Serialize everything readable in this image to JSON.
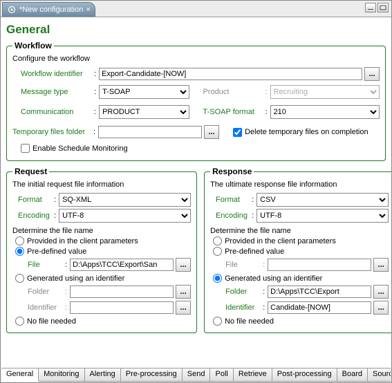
{
  "window": {
    "tab_title": "*New configuration",
    "minimize_tip": "Minimize",
    "maximize_tip": "Maximize"
  },
  "page_title": "General",
  "workflow": {
    "legend": "Workflow",
    "desc": "Configure the workflow",
    "identifier_label": "Workflow identifier",
    "identifier_value": "Export-Candidate-[NOW]",
    "message_type_label": "Message type",
    "message_type_value": "T-SOAP",
    "communication_label": "Communication",
    "communication_value": "PRODUCT",
    "product_label": "Product",
    "product_value": "Recruiting",
    "tsoap_format_label": "T-SOAP format",
    "tsoap_format_value": "210",
    "temp_folder_label": "Temporary files folder",
    "temp_folder_value": "",
    "delete_temp_label": "Delete temporary files on completion",
    "enable_schedule_label": "Enable Schedule Monitoring"
  },
  "request": {
    "legend": "Request",
    "desc": "The initial request file information",
    "format_label": "Format",
    "format_value": "SQ-XML",
    "encoding_label": "Encoding",
    "encoding_value": "UTF-8",
    "determine_label": "Determine the file name",
    "opt_client": "Provided in the client parameters",
    "opt_predef": "Pre-defined value",
    "file_label": "File",
    "file_value": "D:\\Apps\\TCC\\Export\\San",
    "opt_gen": "Generated using an identifier",
    "folder_label": "Folder",
    "folder_value": "",
    "identifier_sub_label": "Identifier",
    "identifier_sub_value": "",
    "opt_none": "No file needed"
  },
  "response": {
    "legend": "Response",
    "desc": "The ultimate response file information",
    "format_label": "Format",
    "format_value": "CSV",
    "encoding_label": "Encoding",
    "encoding_value": "UTF-8",
    "determine_label": "Determine the file name",
    "opt_client": "Provided in the client parameters",
    "opt_predef": "Pre-defined value",
    "file_label": "File",
    "file_value": "",
    "opt_gen": "Generated using an identifier",
    "folder_label": "Folder",
    "folder_value": "D:\\Apps\\TCC\\Export",
    "identifier_sub_label": "Identifier",
    "identifier_sub_value": "Candidate-[NOW]",
    "opt_none": "No file needed"
  },
  "bottom_tabs": [
    "General",
    "Monitoring",
    "Alerting",
    "Pre-processing",
    "Send",
    "Poll",
    "Retrieve",
    "Post-processing",
    "Board",
    "Source"
  ],
  "ellipsis": "..."
}
